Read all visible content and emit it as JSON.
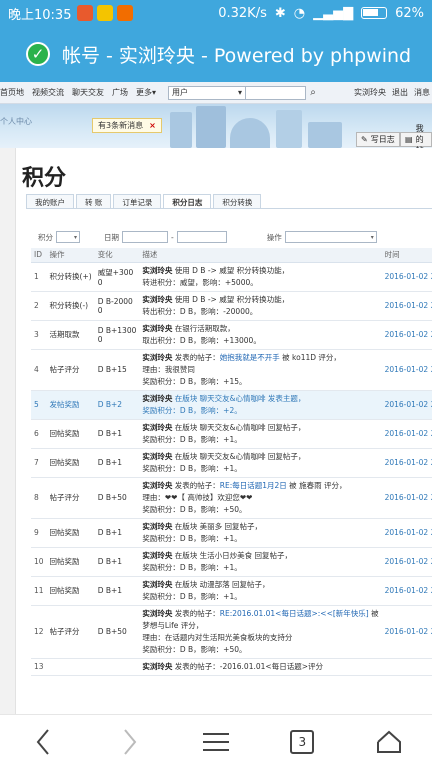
{
  "status": {
    "time": "晚上10:35",
    "speed": "0.32K/s",
    "battery": "62%"
  },
  "title": "帐号 - 实浏玲央 - Powered by phpwind",
  "nav": {
    "links": [
      "首页地",
      "视频交流",
      "聊天交友",
      "广场",
      "更多▾"
    ],
    "search_select": "用户",
    "user": "实浏玲央",
    "logout": "退出",
    "msg": "消息"
  },
  "banner": {
    "crumb": "个人中心",
    "tip": "有3条新消息",
    "tip_close": "×",
    "btn_diary": "写日志",
    "btn_post": "我的帖"
  },
  "page_title": "积分",
  "tabs": [
    "我的账户",
    "转 账",
    "订单记录",
    "积分日志",
    "积分转换"
  ],
  "filters": {
    "type_label": "积分",
    "date_label": "日期",
    "date_sep": "-",
    "op_label": "操作"
  },
  "table": {
    "headers": [
      "ID",
      "操作",
      "变化",
      "描述",
      "时间"
    ],
    "rows": [
      {
        "id": "1",
        "op": "积分转换(+)",
        "amt": [
          "威望+300",
          "0"
        ],
        "lines": [
          [
            [
              "nm",
              "实浏玲央"
            ],
            [
              "t",
              " 使用 D B -> 威望 积分转换功能，"
            ]
          ],
          [
            [
              "t",
              "转进积分：威望，影响：+5000。"
            ]
          ]
        ],
        "time": "2016-01-02 2"
      },
      {
        "id": "2",
        "op": "积分转换(-)",
        "amt": [
          "D B-2000",
          "0"
        ],
        "lines": [
          [
            [
              "nm",
              "实浏玲央"
            ],
            [
              "t",
              " 使用 D B -> 威望 积分转换功能，"
            ]
          ],
          [
            [
              "t",
              "转出积分：D B，影响：-20000。"
            ]
          ]
        ],
        "time": "2016-01-02 2"
      },
      {
        "id": "3",
        "op": "活期取款",
        "amt": [
          "D B+1300",
          "0"
        ],
        "lines": [
          [
            [
              "nm",
              "实浏玲央"
            ],
            [
              "t",
              " 在银行活期取款，"
            ]
          ],
          [
            [
              "t",
              "取出积分：D B，影响：+13000。"
            ]
          ]
        ],
        "time": "2016-01-02 2"
      },
      {
        "id": "4",
        "op": "帖子评分",
        "amt": [
          "D B+15"
        ],
        "lines": [
          [
            [
              "nm",
              "实浏玲央"
            ],
            [
              "t",
              " 发表的帖子："
            ],
            [
              "lk",
              "她抱我就是不开手"
            ],
            [
              "t",
              " 被 ko11D 评分，"
            ]
          ],
          [
            [
              "t",
              "理由：我很赞同"
            ]
          ],
          [
            [
              "t",
              "奖励积分：D B，影响：+15。"
            ]
          ]
        ],
        "time": "2016-01-02 2"
      },
      {
        "id": "5",
        "op": "发帖奖励",
        "amt": [
          "D B+2"
        ],
        "hl": true,
        "lines": [
          [
            [
              "nm",
              "实浏玲央"
            ],
            [
              "t",
              " 在版块 聊天交友&心情咖啡 发表主题，"
            ]
          ],
          [
            [
              "t",
              "奖励积分：D B，影响：+2。"
            ]
          ]
        ],
        "time": "2016-01-02 2"
      },
      {
        "id": "6",
        "op": "回帖奖励",
        "amt": [
          "D B+1"
        ],
        "lines": [
          [
            [
              "nm",
              "实浏玲央"
            ],
            [
              "t",
              " 在版块 聊天交友&心情咖啡 回复帖子，"
            ]
          ],
          [
            [
              "t",
              "奖励积分：D B，影响：+1。"
            ]
          ]
        ],
        "time": "2016-01-02 2"
      },
      {
        "id": "7",
        "op": "回帖奖励",
        "amt": [
          "D B+1"
        ],
        "lines": [
          [
            [
              "nm",
              "实浏玲央"
            ],
            [
              "t",
              " 在版块 聊天交友&心情咖啡 回复帖子，"
            ]
          ],
          [
            [
              "t",
              "奖励积分：D B，影响：+1。"
            ]
          ]
        ],
        "time": "2016-01-02 2"
      },
      {
        "id": "8",
        "op": "帖子评分",
        "amt": [
          "D B+50"
        ],
        "lines": [
          [
            [
              "nm",
              "实浏玲央"
            ],
            [
              "t",
              " 发表的帖子："
            ],
            [
              "lk",
              "RE:每日话题1月2日"
            ],
            [
              "t",
              " 被 施春雨 评分，"
            ]
          ],
          [
            [
              "t",
              "理由：❤❤【 高帅技】欢迎您❤❤"
            ]
          ],
          [
            [
              "t",
              "奖励积分：D B，影响：+50。"
            ]
          ]
        ],
        "time": "2016-01-02 2"
      },
      {
        "id": "9",
        "op": "回帖奖励",
        "amt": [
          "D B+1"
        ],
        "lines": [
          [
            [
              "nm",
              "实浏玲央"
            ],
            [
              "t",
              " 在版块 美丽多 回复帖子，"
            ]
          ],
          [
            [
              "t",
              "奖励积分：D B，影响：+1。"
            ]
          ]
        ],
        "time": "2016-01-02 2"
      },
      {
        "id": "10",
        "op": "回帖奖励",
        "amt": [
          "D B+1"
        ],
        "lines": [
          [
            [
              "nm",
              "实浏玲央"
            ],
            [
              "t",
              " 在版块 生活小日炒美食 回复帖子，"
            ]
          ],
          [
            [
              "t",
              "奖励积分：D B，影响：+1。"
            ]
          ]
        ],
        "time": "2016-01-02 2"
      },
      {
        "id": "11",
        "op": "回帖奖励",
        "amt": [
          "D B+1"
        ],
        "lines": [
          [
            [
              "nm",
              "实浏玲央"
            ],
            [
              "t",
              " 在版块 动漫部落 回复帖子，"
            ]
          ],
          [
            [
              "t",
              "奖励积分：D B，影响：+1。"
            ]
          ]
        ],
        "time": "2016-01-02 2"
      },
      {
        "id": "12",
        "op": "帖子评分",
        "amt": [
          "D B+50"
        ],
        "lines": [
          [
            [
              "nm",
              "实浏玲央"
            ],
            [
              "t",
              " 发表的帖子："
            ],
            [
              "lk",
              "RE:2016.01.01<每日话题>:<<[新年快乐]"
            ],
            [
              "t",
              " 被"
            ]
          ],
          [
            [
              "t",
              "梦想与Life 评分，"
            ]
          ],
          [
            [
              "t",
              "理由：在话题内对生活阳光美食板块的支持分"
            ]
          ],
          [
            [
              "t",
              "奖励积分：D B，影响：+50。"
            ]
          ]
        ],
        "time": "2016-01-02 2"
      },
      {
        "id": "13",
        "op": "",
        "amt": [
          ""
        ],
        "lines": [
          [
            [
              "nm",
              "实浏玲央"
            ],
            [
              "t",
              " 发表的帖子：-2016.01.01<每日话题>评分"
            ]
          ]
        ],
        "time": ""
      }
    ]
  },
  "bottom": {
    "tabs_count": "3"
  }
}
